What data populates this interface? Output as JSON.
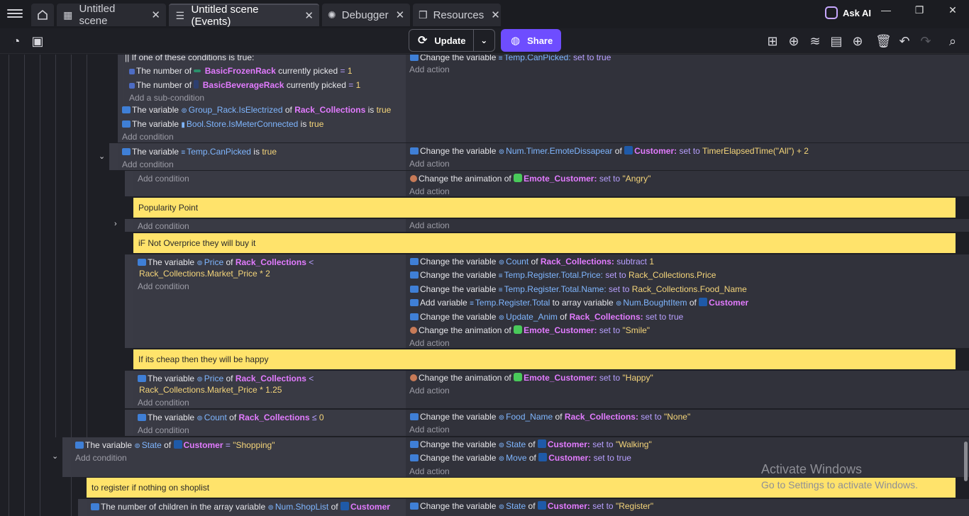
{
  "tabs": [
    {
      "label": "Untitled scene",
      "icon": "film-icon"
    },
    {
      "label": "Untitled scene (Events)",
      "icon": "list-icon"
    },
    {
      "label": "Debugger",
      "icon": "bug-icon"
    },
    {
      "label": "Resources",
      "icon": "resources-icon"
    }
  ],
  "ask_ai": "Ask AI",
  "toolbar": {
    "update": "Update",
    "share": "Share"
  },
  "add_condition": "Add condition",
  "add_action": "Add action",
  "add_subcondition": "Add a sub-condition",
  "comments": {
    "popularity": "Popularity Point",
    "not_overprice": "iF Not Overprice they will buy it",
    "cheap": "If its cheap then they will be happy",
    "register": "to register if nothing on shoplist"
  },
  "events": {
    "or_header": "If one of these conditions is true:",
    "frozen_prefix": "The number of",
    "frozen_obj": "BasicFrozenRack",
    "picked_suffix": "currently picked",
    "eq": "=",
    "one": "1",
    "bev_obj": "BasicBeverageRack",
    "the_variable": "The variable",
    "of": "of",
    "is": "is",
    "true": "true",
    "group_rack": "Group_Rack.IsElectrized",
    "rack_collections": "Rack_Collections",
    "bool_store": "Bool.Store.IsMeterConnected",
    "temp_canpicked": "Temp.CanPicked",
    "price": "Price",
    "lt": "<",
    "market_price_2": "Rack_Collections.Market_Price * 2",
    "market_price_125": "Rack_Collections.Market_Price * 1.25",
    "count": "Count",
    "le": "≤",
    "zero": "0",
    "state": "State",
    "customer": "Customer",
    "shopping": "\"Shopping\"",
    "children_prefix": "The number of children in the array variable",
    "num_shoplist": "Num.ShopList"
  },
  "actions": {
    "change_variable": "Change the variable",
    "change_animation": "Change the animation of",
    "add_variable": "Add variable",
    "to_array": "to array variable",
    "set_to": "set to",
    "subtract": "subtract",
    "set_to_true": "set to true",
    "temp_canpicked": "Temp.CanPicked",
    "num_timer": "Num.Timer.EmoteDissapear",
    "customer_colon": "Customer:",
    "timer_value": "TimerElapsedTime(\"All\") + 2",
    "emote_customer": "Emote_Customer:",
    "angry": "\"Angry\"",
    "count": "Count",
    "rack_collections_colon": "Rack_Collections:",
    "one": "1",
    "reg_total_price": "Temp.Register.Total.Price:",
    "rack_price": "Rack_Collections.Price",
    "reg_total_name": "Temp.Register.Total.Name:",
    "rack_food_name": "Rack_Collections.Food_Name",
    "reg_total": "Temp.Register.Total",
    "num_bought": "Num.BoughtItem",
    "customer": "Customer",
    "update_anim": "Update_Anim",
    "smile": "\"Smile\"",
    "happy": "\"Happy\"",
    "food_name": "Food_Name",
    "none": "\"None\"",
    "state": "State",
    "walking": "\"Walking\"",
    "move": "Move",
    "register": "\"Register\""
  },
  "watermark": {
    "title": "Activate Windows",
    "subtitle": "Go to Settings to activate Windows."
  }
}
